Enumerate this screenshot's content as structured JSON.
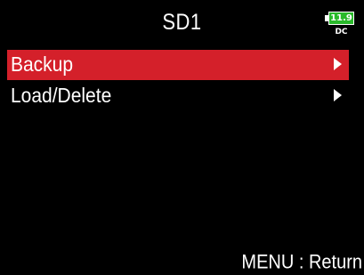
{
  "header": {
    "title": "SD1",
    "battery": {
      "voltage": "11.9",
      "source": "DC",
      "color": "#29b92a"
    }
  },
  "menu": {
    "selected_index": 0,
    "selected_color": "#d4202a",
    "items": [
      {
        "label": "Backup",
        "icon": "chevron-right-icon"
      },
      {
        "label": "Load/Delete",
        "icon": "chevron-right-icon"
      }
    ]
  },
  "footer": {
    "hint": "MENU : Return"
  }
}
